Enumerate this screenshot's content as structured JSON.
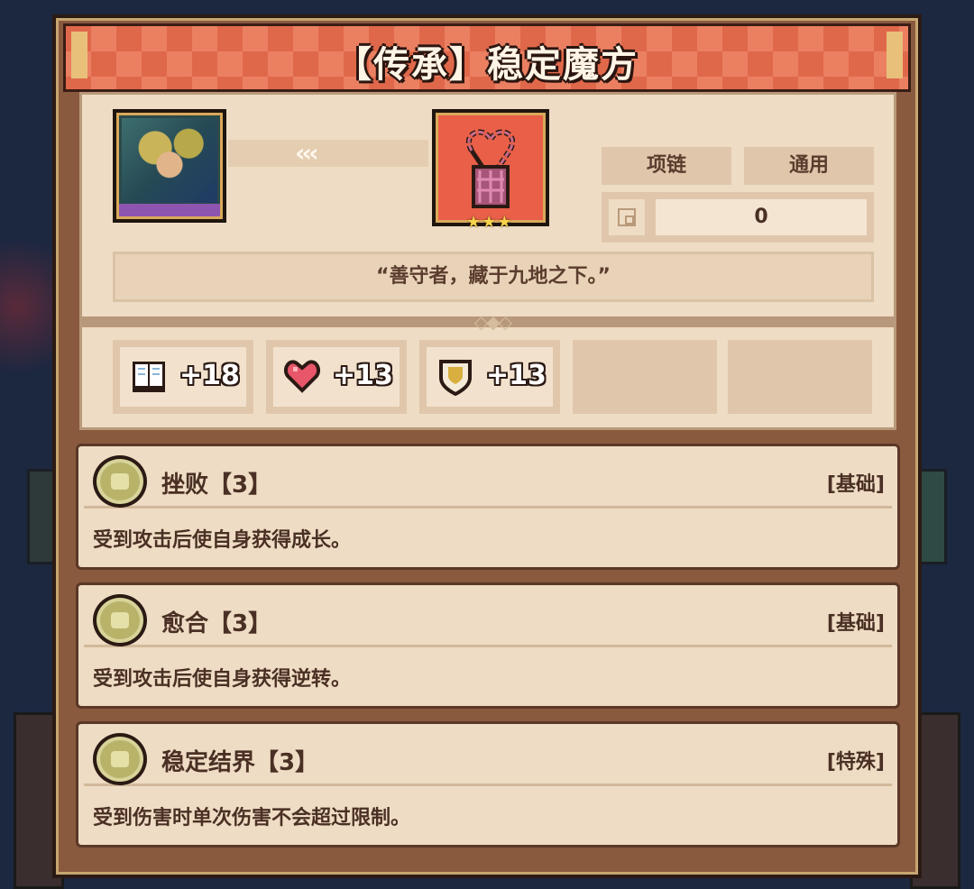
{
  "title": "【传承】稳定魔方",
  "top": {
    "portrait_icon": "character-portrait",
    "item_icon": "necklace-icon",
    "item_stars": "★★★",
    "arrows": "‹‹‹",
    "tags": [
      "项链",
      "通用"
    ],
    "stat_value": "0",
    "quote": "“善守者，藏于九地之下。”"
  },
  "attributes": [
    {
      "icon": "book-icon",
      "value": "+18"
    },
    {
      "icon": "heart-icon",
      "value": "+13"
    },
    {
      "icon": "shield-icon",
      "value": "+13"
    }
  ],
  "skills": [
    {
      "name": "挫败【3】",
      "type": "[基础]",
      "desc": "受到攻击后使自身获得成长。"
    },
    {
      "name": "愈合【3】",
      "type": "[基础]",
      "desc": "受到攻击后使自身获得逆转。"
    },
    {
      "name": "稳定结界【3】",
      "type": "[特殊]",
      "desc": "受到伤害时单次伤害不会超过限制。"
    }
  ],
  "colors": {
    "title_bar": "#e0684a",
    "panel": "#8a5a3e",
    "paper": "#efdcc4",
    "text": "#4a3024"
  }
}
